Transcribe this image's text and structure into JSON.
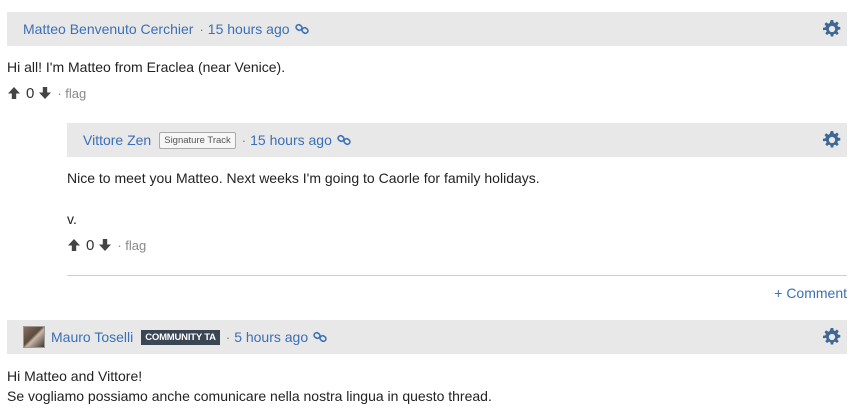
{
  "posts": [
    {
      "author": "Matteo Benvenuto Cerchier",
      "separator": "·",
      "time": "15 hours ago",
      "body": [
        "Hi all! I'm Matteo from Eraclea (near Venice)."
      ],
      "votes": "0",
      "flag": "· flag"
    },
    {
      "author": "Vittore Zen",
      "badge": "Signature Track",
      "separator": "·",
      "time": "15 hours ago",
      "body": [
        "Nice to meet you Matteo. Next weeks I'm going to Caorle for family holidays.",
        "v."
      ],
      "votes": "0",
      "flag": "· flag"
    },
    {
      "author": "Mauro Toselli",
      "badge": "COMMUNITY TA",
      "separator": "·",
      "time": "5 hours ago",
      "body": [
        "Hi Matteo and Vittore!",
        "Se vogliamo possiamo anche comunicare nella nostra lingua in questo thread."
      ]
    }
  ],
  "add_comment": "+ Comment",
  "colors": {
    "link": "#3b6fb6",
    "header_bg": "#e8e8e8",
    "badge_cta_bg": "#3a4654"
  },
  "icons": {
    "gear": "gear-icon",
    "link": "link-icon",
    "up": "arrow-up-icon",
    "down": "arrow-down-icon"
  }
}
